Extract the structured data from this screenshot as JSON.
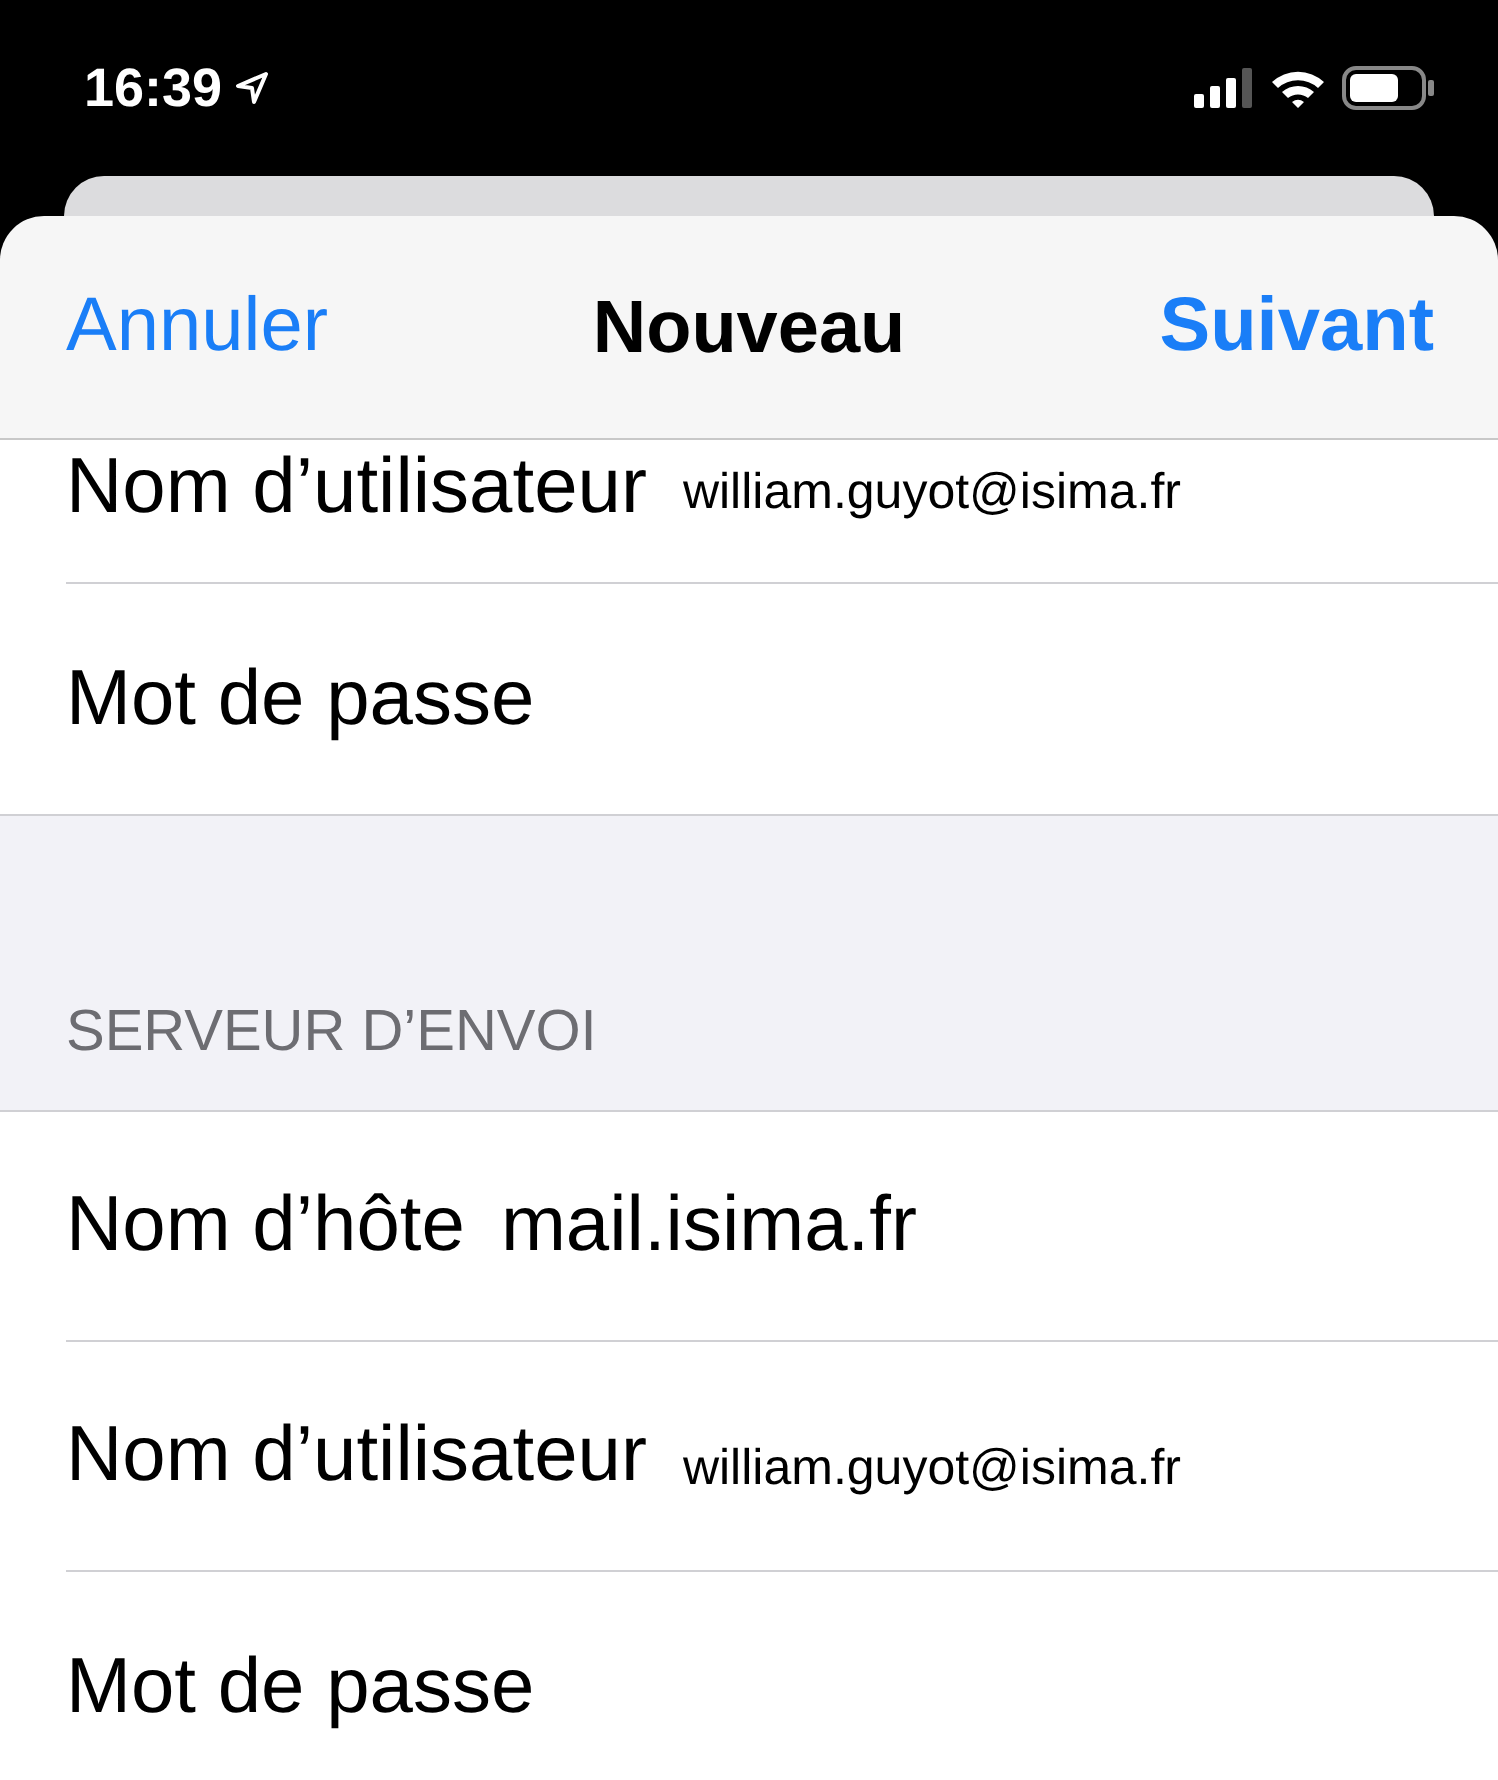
{
  "status_bar": {
    "time": "16:39"
  },
  "nav": {
    "cancel": "Annuler",
    "title": "Nouveau",
    "next": "Suivant"
  },
  "sections": [
    {
      "rows": [
        {
          "label": "Nom d’utilisateur",
          "value": "william.guyot@isima.fr",
          "kind": "email"
        },
        {
          "label": "Mot de passe",
          "kind": "password"
        }
      ]
    },
    {
      "header": "SERVEUR D’ENVOI",
      "rows": [
        {
          "label": "Nom d’hôte",
          "value": "mail.isima.fr",
          "kind": "host"
        },
        {
          "label": "Nom d’utilisateur",
          "value": "william.guyot@isima.fr",
          "kind": "email"
        },
        {
          "label": "Mot de passe",
          "kind": "password"
        }
      ]
    }
  ]
}
